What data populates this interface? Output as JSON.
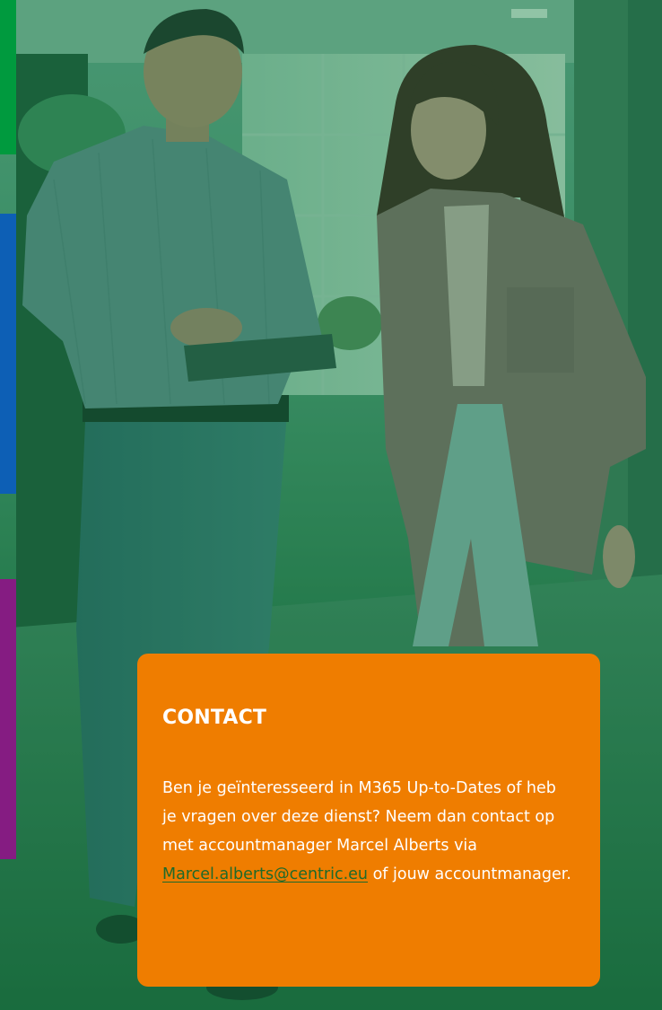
{
  "colors": {
    "accent_green": "#009a3e",
    "accent_blue": "#0d5fb5",
    "accent_purple": "#851c82",
    "card_orange": "#ef7d00",
    "overlay_green": "#1d7a4a",
    "link_green": "#1f6a2a"
  },
  "hero": {
    "image": "photo-two-colleagues-walking-with-tablet-green-tint"
  },
  "contact": {
    "title": "CONTACT",
    "text_before_link": "Ben je geïnteresseerd in M365 Up-to-Dates of heb je vragen over deze dienst? Neem dan contact op met accountmanager Marcel Alberts via ",
    "email_link": "Marcel.alberts@centric.eu",
    "text_after_link": " of jouw accountmanager."
  }
}
